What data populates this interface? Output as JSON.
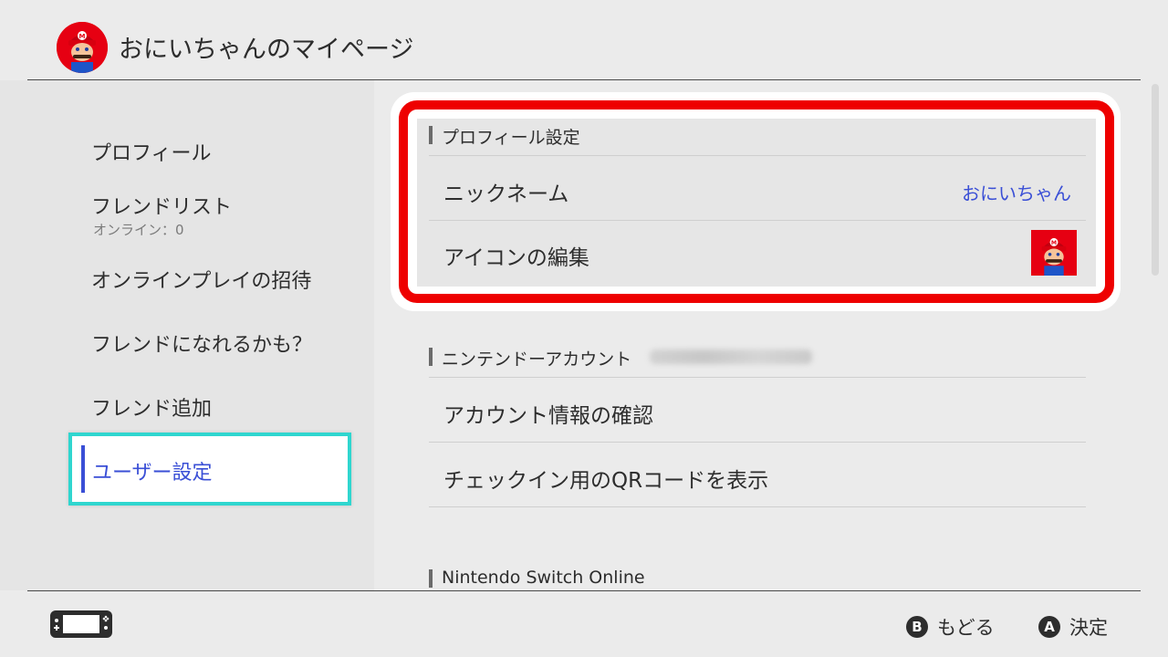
{
  "header": {
    "title": "おにいちゃんのマイページ",
    "avatar_icon": "mario-avatar-icon"
  },
  "sidebar": {
    "items": [
      {
        "label": "プロフィール"
      },
      {
        "label": "フレンドリスト",
        "sub": "オンライン：0"
      },
      {
        "label": "オンラインプレイの招待"
      },
      {
        "label": "フレンドになれるかも？"
      },
      {
        "label": "フレンド追加"
      },
      {
        "label": "ユーザー設定",
        "selected": true
      }
    ]
  },
  "main": {
    "profile_section": {
      "heading": "プロフィール設定",
      "nickname_label": "ニックネーム",
      "nickname_value": "おにいちゃん",
      "icon_edit_label": "アイコンの編集"
    },
    "account_section": {
      "heading": "ニンテンドーアカウント",
      "items": [
        "アカウント情報の確認",
        "チェックイン用のQRコードを表示"
      ]
    },
    "online_section": {
      "heading": "Nintendo Switch Online"
    }
  },
  "footer": {
    "back_button": "B",
    "back_label": "もどる",
    "confirm_button": "A",
    "confirm_label": "決定"
  },
  "colors": {
    "accent_blue": "#3a4fd6",
    "highlight_red": "#ee0000",
    "selection_cyan": "#2fd6cf",
    "mario_red": "#e60012"
  }
}
